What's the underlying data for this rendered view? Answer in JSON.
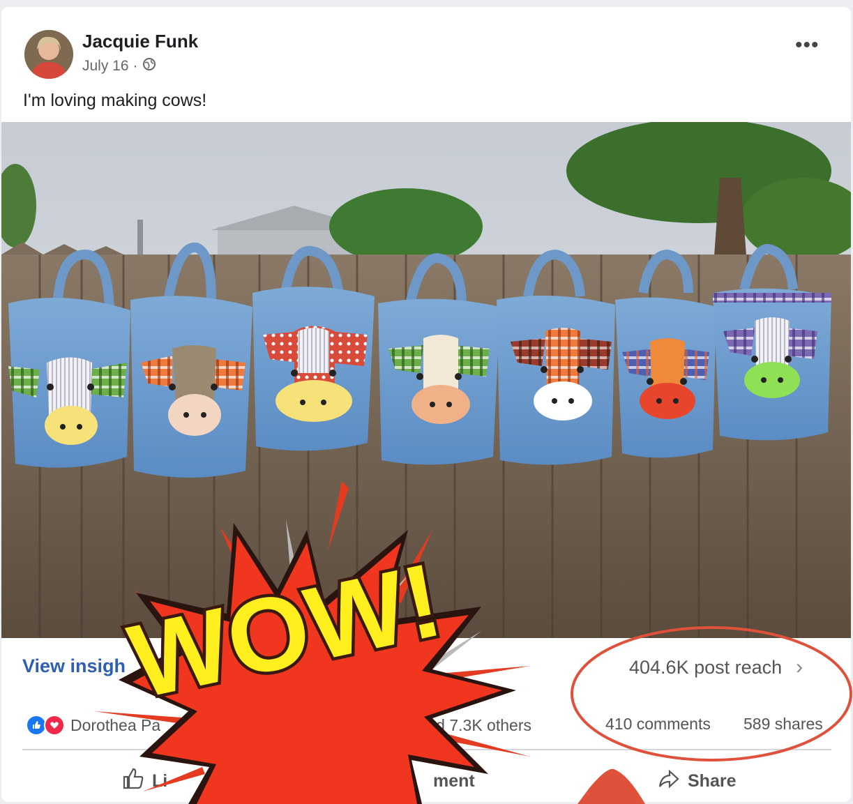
{
  "post": {
    "author": "Jacquie Funk",
    "date": "July 16",
    "separator": "·",
    "privacy_icon": "globe-icon",
    "more_label": "•••",
    "caption": "I'm loving making cows!"
  },
  "insights": {
    "view_insights": "View insigh",
    "reach": "404.6K post reach",
    "chevron": "›"
  },
  "engagement": {
    "reactions_text": "Dorothea Pa",
    "reactions_tail": "sler and 7.3K others",
    "comments": "410 comments",
    "shares": "589 shares"
  },
  "actions": {
    "like": "Li",
    "comment": "ment",
    "share": "Share"
  },
  "sticker": {
    "text": "WOW!"
  },
  "colors": {
    "accent_blue": "#2e5fb0",
    "annotation_red": "#e0513c",
    "burst_red": "#f0361e",
    "burst_yellow": "#ffef1f"
  }
}
